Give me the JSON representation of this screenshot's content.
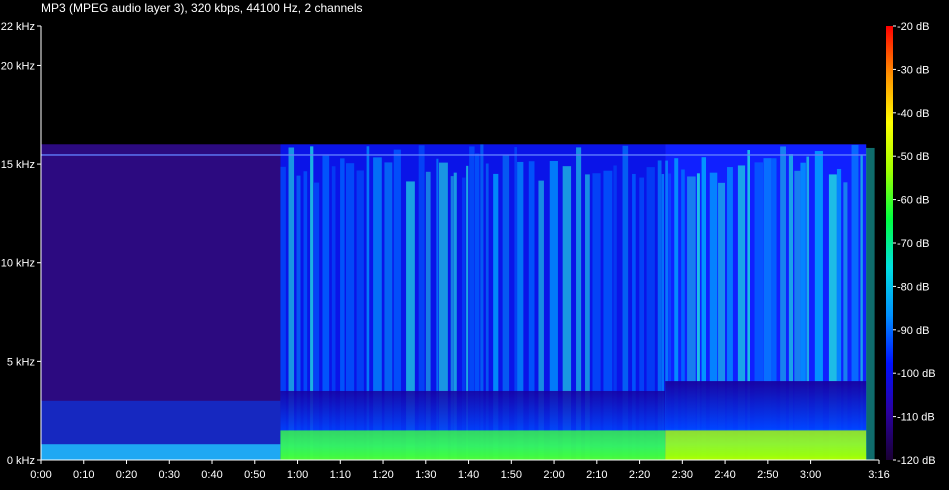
{
  "header": {
    "format_info": "MP3 (MPEG audio layer 3), 320 kbps, 44100 Hz, 2 channels"
  },
  "chart_data": {
    "type": "heatmap",
    "title": "",
    "xlabel": "",
    "ylabel": "",
    "x_ticks": [
      "0:00",
      "0:10",
      "0:20",
      "0:30",
      "0:40",
      "0:50",
      "1:00",
      "1:10",
      "1:20",
      "1:30",
      "1:40",
      "1:50",
      "2:00",
      "2:10",
      "2:20",
      "2:30",
      "2:40",
      "2:50",
      "3:00",
      "3:16"
    ],
    "x_tick_seconds": [
      0,
      10,
      20,
      30,
      40,
      50,
      60,
      70,
      80,
      90,
      100,
      110,
      120,
      130,
      140,
      150,
      160,
      170,
      180,
      196
    ],
    "y_ticks": [
      "22 kHz",
      "20 kHz",
      "15 kHz",
      "10 kHz",
      "5 kHz",
      "0 kHz"
    ],
    "y_tick_khz": [
      22,
      20,
      15,
      10,
      5,
      0
    ],
    "xlim_seconds": [
      0,
      196
    ],
    "ylim_khz": [
      0,
      22
    ],
    "colorbar_ticks": [
      "-20 dB",
      "-30 dB",
      "-40 dB",
      "-50 dB",
      "-60 dB",
      "-70 dB",
      "-80 dB",
      "-90 dB",
      "-100 dB",
      "-110 dB",
      "-120 dB"
    ],
    "colorbar_db": [
      -20,
      -30,
      -40,
      -50,
      -60,
      -70,
      -80,
      -90,
      -100,
      -110,
      -120
    ],
    "colorbar_range_db": [
      -120,
      -20
    ],
    "colormap": [
      "#1a0033",
      "#2a00a0",
      "#0010ff",
      "#0090ff",
      "#00e0e0",
      "#00ff40",
      "#a0ff00",
      "#ffff00",
      "#ff9000",
      "#ff0000"
    ],
    "lowpass_cutoff_khz": 16,
    "audio_end_seconds": 193,
    "sections": [
      {
        "start_s": 0,
        "end_s": 56,
        "level": "quiet"
      },
      {
        "start_s": 56,
        "end_s": 146,
        "level": "loud"
      },
      {
        "start_s": 146,
        "end_s": 193,
        "level": "louder"
      }
    ],
    "grid": false
  }
}
